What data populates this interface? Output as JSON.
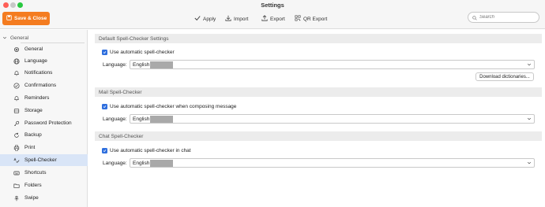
{
  "window": {
    "title": "Settings"
  },
  "toolbar": {
    "save_close_label": "Save & Close",
    "apply_label": "Apply",
    "import_label": "Import",
    "export_label": "Export",
    "qr_export_label": "QR Export",
    "search_placeholder": "Search"
  },
  "sidebar": {
    "group_label": "General",
    "items": [
      {
        "label": "General",
        "icon": "gear-icon"
      },
      {
        "label": "Language",
        "icon": "globe-icon"
      },
      {
        "label": "Notifications",
        "icon": "bell-icon"
      },
      {
        "label": "Confirmations",
        "icon": "check-circle-icon"
      },
      {
        "label": "Reminders",
        "icon": "bell-icon"
      },
      {
        "label": "Storage",
        "icon": "storage-icon"
      },
      {
        "label": "Password Protection",
        "icon": "key-icon"
      },
      {
        "label": "Backup",
        "icon": "backup-icon"
      },
      {
        "label": "Print",
        "icon": "printer-icon"
      },
      {
        "label": "Spell-Checker",
        "icon": "spellcheck-icon",
        "active": true
      },
      {
        "label": "Shortcuts",
        "icon": "keyboard-icon"
      },
      {
        "label": "Folders",
        "icon": "folder-icon"
      },
      {
        "label": "Swipe",
        "icon": "swipe-icon"
      }
    ]
  },
  "sections": {
    "default": {
      "title": "Default Spell-Checker Settings",
      "checkbox_label": "Use automatic spell-checker",
      "checked": true,
      "language_label": "Language:",
      "language_value": "English",
      "download_button": "Download dictionaries..."
    },
    "mail": {
      "title": "Mail Spell-Checker",
      "checkbox_label": "Use automatic spell-checker when composing message",
      "checked": true,
      "language_label": "Language:",
      "language_value": "English"
    },
    "chat": {
      "title": "Chat Spell-Checker",
      "checkbox_label": "Use automatic spell-checker in chat",
      "checked": true,
      "language_label": "Language:",
      "language_value": "English"
    }
  },
  "colors": {
    "accent": "#f47c20",
    "checkbox": "#2f6fde",
    "selected_row": "#d9e5f7"
  }
}
